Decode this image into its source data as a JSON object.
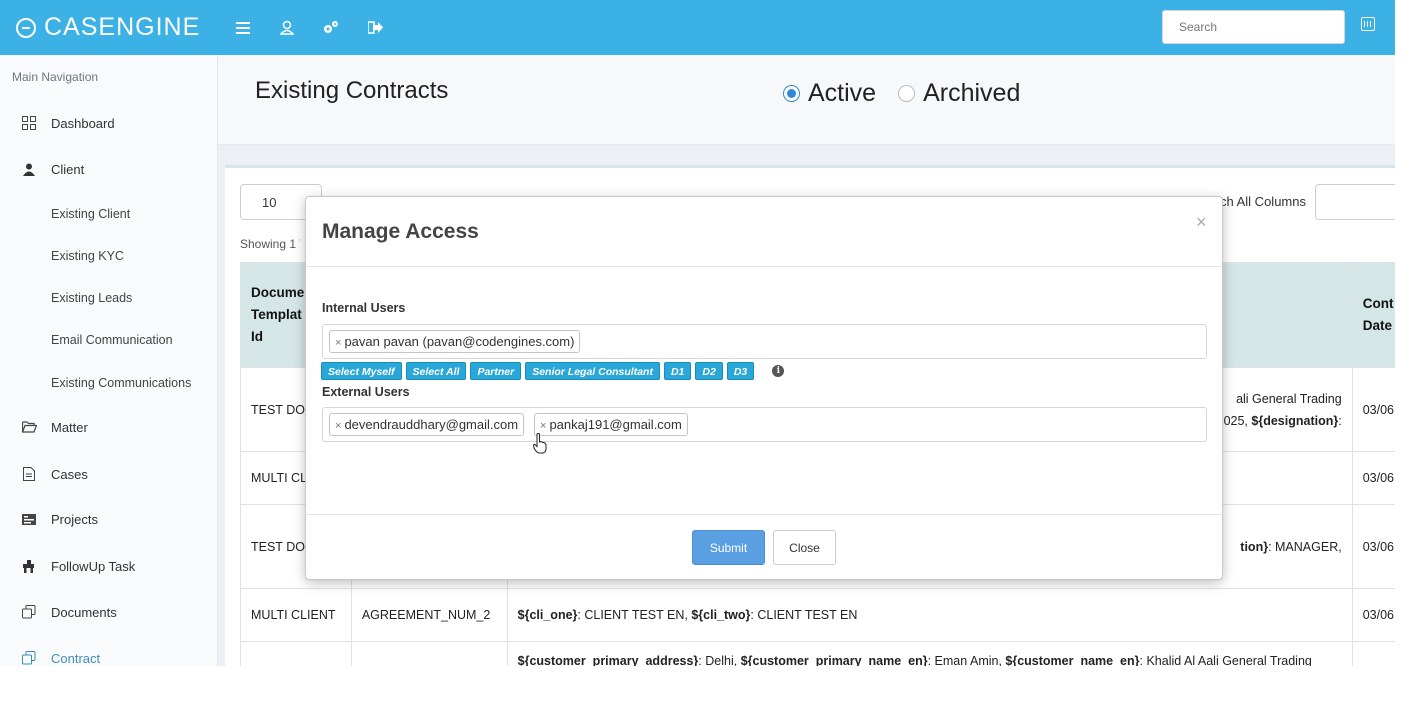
{
  "brand": {
    "name": "CASENGINE"
  },
  "topbar": {
    "icons": [
      "menu-icon",
      "user-icon",
      "settings-icon",
      "logout-icon"
    ],
    "search_placeholder": "Search",
    "calendar_icon": "calendar-icon"
  },
  "sidebar": {
    "header": "Main Navigation",
    "items": [
      {
        "label": "Dashboard",
        "icon": "dashboard-icon"
      },
      {
        "label": "Client",
        "icon": "user-icon"
      },
      {
        "label": "Existing Client"
      },
      {
        "label": "Existing KYC"
      },
      {
        "label": "Existing Leads"
      },
      {
        "label": "Email Communication"
      },
      {
        "label": "Existing Communications"
      },
      {
        "label": "Matter",
        "icon": "folder-open-icon"
      },
      {
        "label": "Cases",
        "icon": "file-icon"
      },
      {
        "label": "Projects",
        "icon": "projects-icon"
      },
      {
        "label": "FollowUp Task",
        "icon": "puzzle-icon"
      },
      {
        "label": "Documents",
        "icon": "copy-icon"
      },
      {
        "label": "Contract",
        "icon": "copy-icon"
      }
    ]
  },
  "page": {
    "title": "Existing Contracts",
    "filter": {
      "active": "Active",
      "archived": "Archived",
      "selected": "Active"
    }
  },
  "table_controls": {
    "length": "10",
    "showing": "Showing 1 T",
    "search_label": "ch All Columns"
  },
  "table": {
    "headers": [
      "Docume Templat Id",
      "",
      "",
      "Cont Date"
    ],
    "header_col1": [
      "Docume",
      "Templat",
      "Id"
    ],
    "header_col4": [
      "Cont",
      "Date"
    ],
    "rows": [
      {
        "c1": "TEST DOC",
        "c3_line1": "ali General Trading",
        "c3_line2_pre": "025, ",
        "c3_line2_key": "${designation}",
        "c3_line2_post": ":",
        "c4": "03/06"
      },
      {
        "c1": "MULTI CLI",
        "c4": "03/06"
      },
      {
        "c1": "TEST DOC",
        "c3_key": "tion}",
        "c3_post": ": MANAGER,",
        "c4": "03/06"
      },
      {
        "c1": "MULTI CLIENT",
        "c2": "AGREEMENT_NUM_2",
        "c3_k1": "${cli_one}",
        "c3_v1": ": CLIENT TEST EN, ",
        "c3_k2": "${cli_two}",
        "c3_v2": ": CLIENT TEST EN",
        "c4": "03/06"
      },
      {
        "c3_k1": "${customer_primary_address}",
        "c3_v1": ": Delhi, ",
        "c3_k2": "${customer_primary_name_en}",
        "c3_v2": ": Eman Amin, ",
        "c3_k3": "${customer_name_en}",
        "c3_v3": ": Khalid Al Aali General Trading"
      }
    ]
  },
  "modal": {
    "title": "Manage Access",
    "close_symbol": "×",
    "internal_label": "Internal Users",
    "internal_tags": [
      "pavan pavan (pavan@codengines.com)"
    ],
    "quick_buttons": [
      "Select Myself",
      "Select All",
      "Partner",
      "Senior Legal Consultant",
      "D1",
      "D2",
      "D3"
    ],
    "external_label": "External Users",
    "external_tags": [
      "devendrauddhary@gmail.com",
      "pankaj191@gmail.com"
    ],
    "submit": "Submit",
    "close": "Close"
  }
}
